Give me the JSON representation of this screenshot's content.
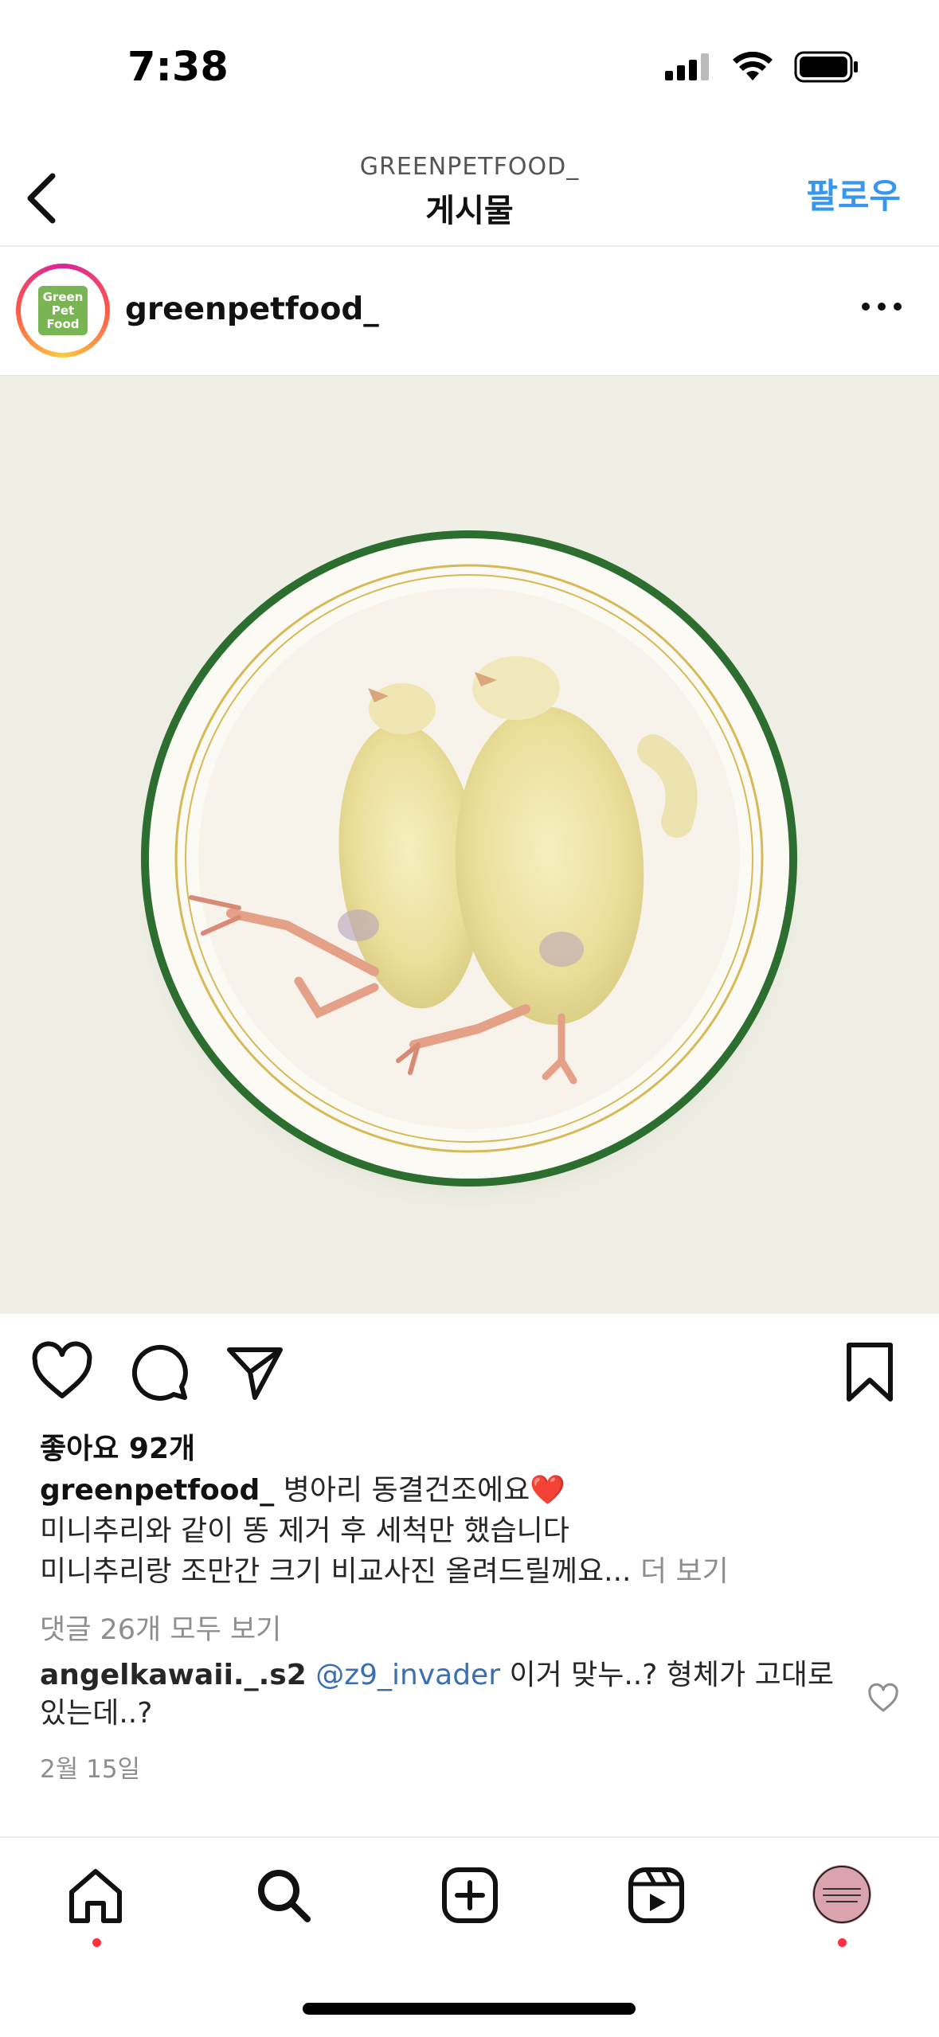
{
  "status": {
    "time": "7:38"
  },
  "header": {
    "account": "GREENPETFOOD_",
    "title": "게시물",
    "follow_label": "팔로우"
  },
  "author": {
    "username": "greenpetfood_",
    "avatar_text": "Green Pet Food"
  },
  "post": {
    "likes": "좋아요 92개",
    "caption_user": "greenpetfood_",
    "caption_line1": " 병아리 동결건조에요❤️",
    "caption_line2": "미니추리와 같이 똥 제거 후 세척만 했습니다",
    "caption_line3": "미니추리랑 조만간 크기 비교사진 올려드릴께요...",
    "more_label": " 더 보기",
    "view_comments": "댓글 26개 모두 보기",
    "comment": {
      "user": "angelkawaii._.s2",
      "mention": "@z9_invader",
      "text": " 이거 맞누..? 형체가 고대로 있는데..?"
    },
    "date": "2월 15일"
  },
  "colors": {
    "accent": "#3797f0",
    "notification": "#ff3040",
    "image_bg": "#f0efe5",
    "plate_rim": "#2e7d32"
  }
}
